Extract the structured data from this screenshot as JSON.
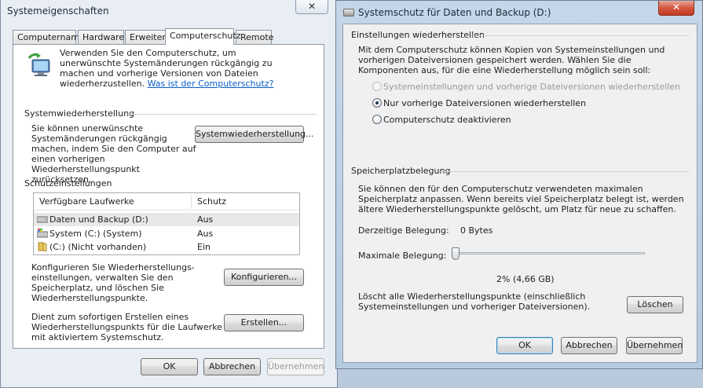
{
  "left_window": {
    "title": "Systemeigenschaften",
    "close_glyph": "✕",
    "tabs": [
      "Computername",
      "Hardware",
      "Erweitert",
      "Computerschutz",
      "Remote"
    ],
    "intro_text": "Verwenden Sie den Computerschutz, um unerwünschte Systemänderungen rückgängig zu machen und vorherige Versionen von Dateien wiederherzustellen.",
    "intro_link": "Was ist der Computerschutz?",
    "restore_group_title": "Systemwiederherstellung",
    "restore_text": "Sie können unerwünschte Systemänderungen rückgängig machen, indem Sie den Computer auf einen vorherigen Wiederherstellungspunkt zurücksetzen.",
    "restore_button": "Systemwiederherstellung...",
    "protection_group_title": "Schutzeinstellungen",
    "table_headers": {
      "drives": "Verfügbare Laufwerke",
      "protection": "Schutz"
    },
    "drives": [
      {
        "name": "Daten und Backup (D:)",
        "status": "Aus"
      },
      {
        "name": "System (C:) (System)",
        "status": "Aus"
      },
      {
        "name": "(C:) (Nicht vorhanden)",
        "status": "Ein"
      }
    ],
    "configure_text": "Konfigurieren Sie Wiederherstellungs-einstellungen, verwalten Sie den Speicherplatz, und löschen Sie Wiederherstellungspunkte.",
    "configure_button": "Konfigurieren...",
    "create_text": "Dient zum sofortigen Erstellen eines Wiederherstellungspunkts für die Laufwerke mit aktiviertem Systemschutz.",
    "create_button": "Erstellen...",
    "ok": "OK",
    "cancel": "Abbrechen",
    "apply": "Übernehmen"
  },
  "right_window": {
    "title": "Systemschutz für Daten und Backup (D:)",
    "close_glyph": "✕",
    "restore_settings_title": "Einstellungen wiederherstellen",
    "restore_settings_text": "Mit dem Computerschutz können Kopien von Systemeinstellungen und vorherigen Dateiversionen gespeichert werden. Wählen Sie die Komponenten aus, für die eine Wiederherstellung möglich sein soll:",
    "options": [
      {
        "label": "Systemeinstellungen und vorherige Dateiversionen wiederherstellen",
        "state": "disabled"
      },
      {
        "label": "Nur vorherige Dateiversionen wiederherstellen",
        "state": "checked"
      },
      {
        "label": "Computerschutz deaktivieren",
        "state": "unchecked"
      }
    ],
    "disk_usage_title": "Speicherplatzbelegung",
    "disk_usage_text": "Sie können den für den Computerschutz verwendeten maximalen Speicherplatz anpassen. Wenn bereits viel Speicherplatz belegt ist, werden ältere Wiederherstellungspunkte gelöscht, um Platz für neue zu schaffen.",
    "current_usage_label": "Derzeitige Belegung:",
    "current_usage_value": "0 Bytes",
    "max_usage_label": "Maximale Belegung:",
    "max_usage_value": "2% (4,66 GB)",
    "max_usage_fraction": 0.02,
    "delete_text": "Löscht alle Wiederherstellungspunkte (einschließlich Systemeinstellungen und vorheriger Dateiversionen).",
    "delete_button": "Löschen",
    "ok": "OK",
    "cancel": "Abbrechen",
    "apply": "Übernehmen"
  }
}
